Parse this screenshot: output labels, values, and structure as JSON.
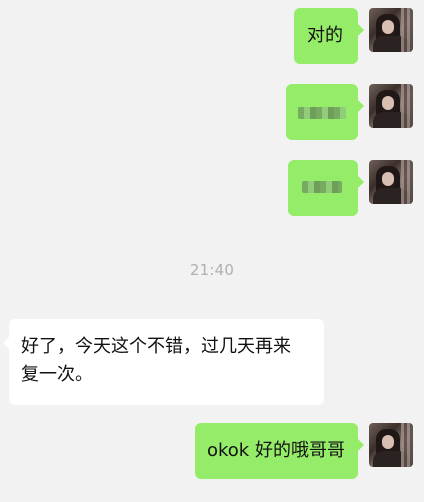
{
  "chat": {
    "messages": [
      {
        "side": "right",
        "text": "对的"
      },
      {
        "side": "right",
        "text": "",
        "content": "pixelated-image"
      },
      {
        "side": "right",
        "text": "",
        "content": "pixelated-image"
      },
      {
        "side": "left",
        "text": "好了，今天这个不错，过几天再来\n复一次。"
      },
      {
        "side": "right",
        "text": "okok 好的哦哥哥"
      }
    ],
    "timestamp": "21:40"
  },
  "colors": {
    "background": "#f2f2f2",
    "sent_bubble": "#95ec69",
    "received_bubble": "#ffffff",
    "timestamp_text": "#b0b0b0"
  },
  "icons": {
    "avatar": "user-avatar-icon"
  }
}
